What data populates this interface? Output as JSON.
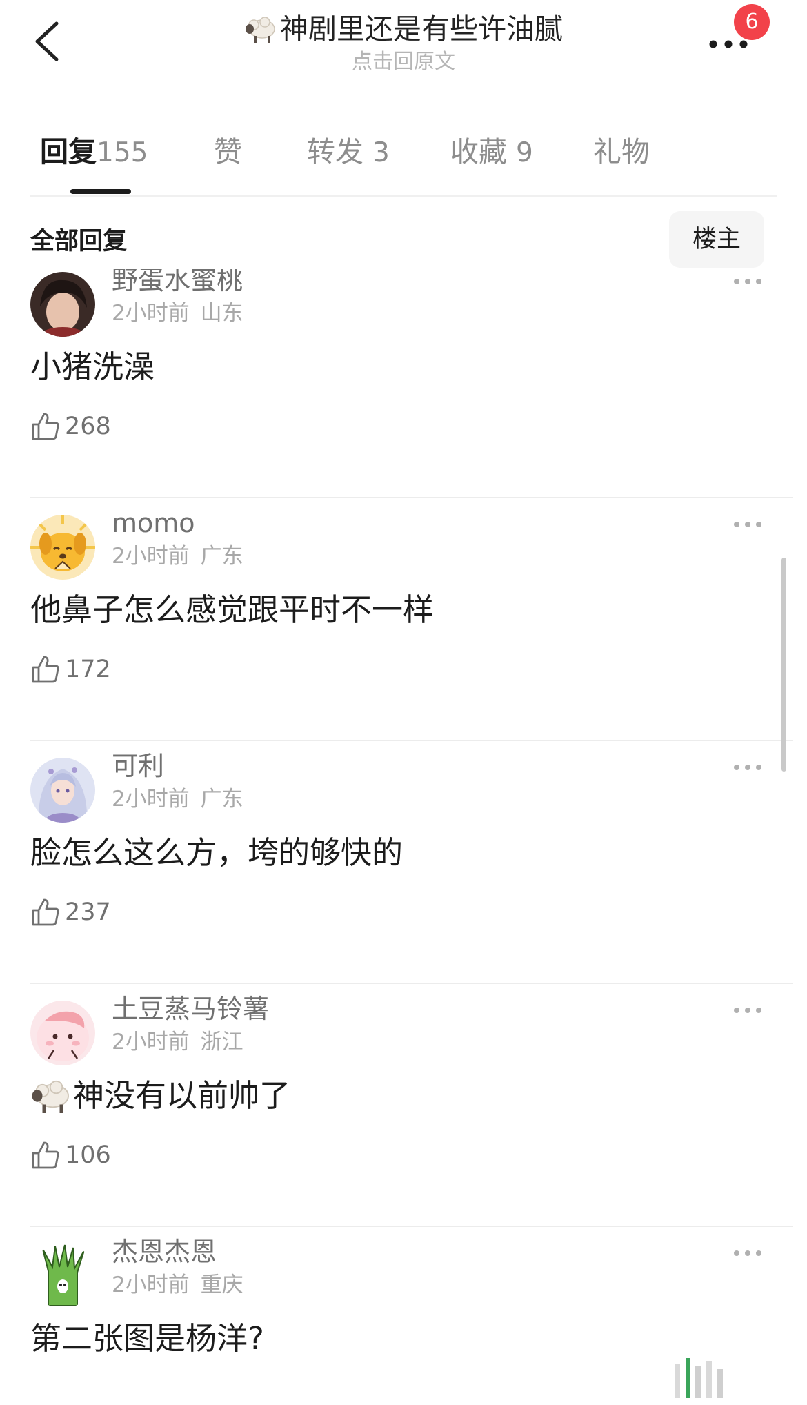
{
  "header": {
    "title_emoji": "sheep",
    "title": "神剧里还是有些许油腻",
    "subtitle": "点击回原文",
    "notification_count": "6"
  },
  "tabs": [
    {
      "label": "回复",
      "count": "155",
      "active": true
    },
    {
      "label": "赞",
      "count": "",
      "active": false
    },
    {
      "label": "转发",
      "count": "3",
      "active": false
    },
    {
      "label": "收藏",
      "count": "9",
      "active": false
    },
    {
      "label": "礼物",
      "count": "",
      "active": false
    }
  ],
  "section": {
    "title": "全部回复",
    "op_filter_label": "楼主"
  },
  "comments": [
    {
      "username": "野蛋水蜜桃",
      "time": "2小时前",
      "location": "山东",
      "text": "小猪洗澡",
      "likes": "268",
      "avatar": "portrait-avatar"
    },
    {
      "username": "momo",
      "time": "2小时前",
      "location": "广东",
      "text": "他鼻子怎么感觉跟平时不一样",
      "likes": "172",
      "avatar": "yellow-dog-avatar"
    },
    {
      "username": "可利",
      "time": "2小时前",
      "location": "广东",
      "text": "脸怎么这么方，垮的够快的",
      "likes": "237",
      "avatar": "anime-girl-avatar"
    },
    {
      "username": "土豆蒸马铃薯",
      "time": "2小时前",
      "location": "浙江",
      "text": "神没有以前帅了",
      "text_emoji": "sheep",
      "likes": "106",
      "avatar": "pink-blob-avatar"
    },
    {
      "username": "杰恩杰恩",
      "time": "2小时前",
      "location": "重庆",
      "text": "第二张图是杨洋?",
      "likes": "",
      "avatar": "green-plant-avatar"
    }
  ],
  "colors": {
    "badge": "#f2424a",
    "primary_text": "#1c1c1c",
    "secondary_text": "#707070",
    "meta_text": "#a8a8a8"
  }
}
